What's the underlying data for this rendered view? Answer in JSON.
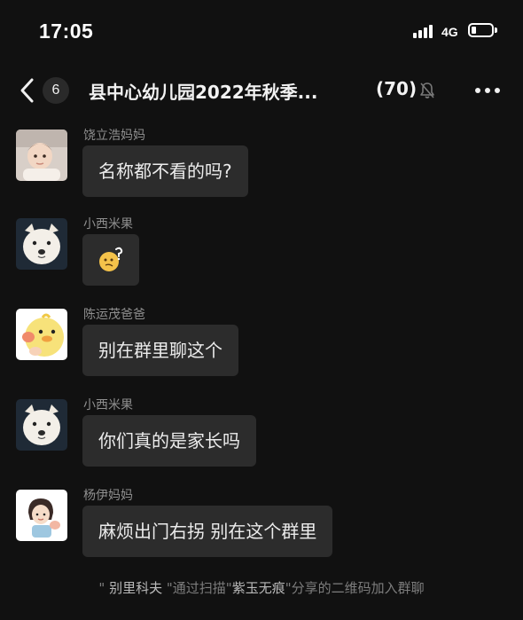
{
  "status_bar": {
    "time": "17:05",
    "network": "4G",
    "battery_level": 0.22
  },
  "header": {
    "unread_count": "6",
    "title": "县中心幼儿园2022年秋季...",
    "member_count": "(70)"
  },
  "messages": [
    {
      "sender": "饶立浩妈妈",
      "text": "名称都不看的吗?",
      "avatar": "baby-photo"
    },
    {
      "sender": "小西米果",
      "text": "",
      "sticker": "confused-face-emoji",
      "avatar": "white-dog-photo"
    },
    {
      "sender": "陈运茂爸爸",
      "text": "别在群里聊这个",
      "avatar": "yellow-duck-cartoon"
    },
    {
      "sender": "小西米果",
      "text": "你们真的是家长吗",
      "avatar": "white-dog-photo"
    },
    {
      "sender": "杨伊妈妈",
      "text": "麻烦出门右拐 别在这个群里",
      "avatar": "girl-cartoon"
    }
  ],
  "system_notice": {
    "quote_open": "\"",
    "inviter": "别里科夫",
    "mid1": "\"通过扫描\"",
    "sharer": "紫玉无痕",
    "mid2": "\"分享的二维码加入群聊"
  },
  "colors": {
    "background": "#111111",
    "bubble": "#2c2c2c",
    "text_primary": "#ececec",
    "text_secondary": "#8f8f8f"
  }
}
